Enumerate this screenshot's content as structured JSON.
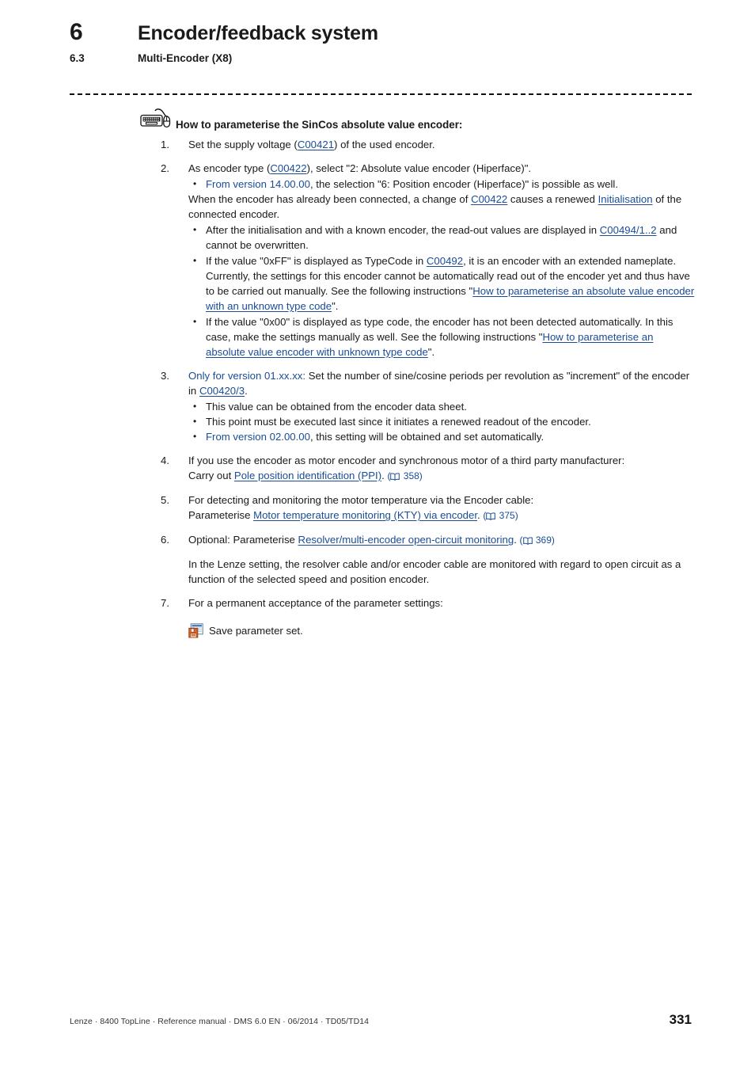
{
  "header": {
    "chapter_number": "6",
    "chapter_title": "Encoder/feedback system",
    "section_number": "6.3",
    "section_title": "Multi-Encoder (X8)"
  },
  "instruction": {
    "icon": "keyboard-mouse-icon",
    "title": "How to parameterise the SinCos absolute value encoder:",
    "steps": [
      {
        "number": "1.",
        "text_parts": [
          {
            "type": "text",
            "value": "Set the supply voltage ("
          },
          {
            "type": "link",
            "value": "C00421"
          },
          {
            "type": "text",
            "value": ") of the used encoder."
          }
        ]
      },
      {
        "number": "2.",
        "text_parts": [
          {
            "type": "text",
            "value": "As encoder type ("
          },
          {
            "type": "link",
            "value": "C00422"
          },
          {
            "type": "text",
            "value": "), select \"2: Absolute value encoder (Hiperface)\"."
          }
        ],
        "bullets": [
          [
            {
              "type": "blue",
              "value": "From version 14.00.00"
            },
            {
              "type": "text",
              "value": ", the selection \"6: Position encoder (Hiperface)\" is possible as well."
            }
          ]
        ],
        "paragraph": [
          {
            "type": "text",
            "value": "When the encoder has already been connected, a change of "
          },
          {
            "type": "link",
            "value": "C00422"
          },
          {
            "type": "text",
            "value": " causes a renewed "
          },
          {
            "type": "link",
            "value": "Initialisation"
          },
          {
            "type": "text",
            "value": " of the connected encoder."
          }
        ],
        "bullets2": [
          [
            {
              "type": "text",
              "value": "After the initialisation and with a known encoder, the read-out values are displayed in "
            },
            {
              "type": "link",
              "value": "C00494/1..2"
            },
            {
              "type": "text",
              "value": " and cannot be overwritten."
            }
          ],
          [
            {
              "type": "text",
              "value": "If the value \"0xFF\" is displayed as TypeCode in "
            },
            {
              "type": "link",
              "value": "C00492"
            },
            {
              "type": "text",
              "value": ", it is an encoder with an extended nameplate. Currently, the settings for this encoder cannot be automatically read out of the encoder yet and thus have to be carried out manually. See the following instructions \""
            },
            {
              "type": "link",
              "value": "How to parameterise an absolute value encoder with an unknown type code"
            },
            {
              "type": "text",
              "value": "\"."
            }
          ],
          [
            {
              "type": "text",
              "value": "If the value \"0x00\" is displayed as type code, the encoder has not been detected automatically. In this case, make the settings manually as well. See the following instructions \""
            },
            {
              "type": "link",
              "value": "How to parameterise an absolute value encoder with unknown type code"
            },
            {
              "type": "text",
              "value": "\"."
            }
          ]
        ]
      },
      {
        "number": "3.",
        "text_parts": [
          {
            "type": "blue",
            "value": "Only for version 01.xx.xx:"
          },
          {
            "type": "text",
            "value": " Set the number of sine/cosine periods per revolution as \"increment\" of the encoder in "
          },
          {
            "type": "link",
            "value": "C00420/3"
          },
          {
            "type": "text",
            "value": "."
          }
        ],
        "bullets": [
          [
            {
              "type": "text",
              "value": "This value can be obtained from the encoder data sheet."
            }
          ],
          [
            {
              "type": "text",
              "value": "This point must be executed last since it initiates a renewed readout of the encoder."
            }
          ],
          [
            {
              "type": "blue",
              "value": "From version 02.00.00"
            },
            {
              "type": "text",
              "value": ", this setting will be obtained and set automatically."
            }
          ]
        ]
      },
      {
        "number": "4.",
        "text_parts": [
          {
            "type": "text",
            "value": "If you use the encoder as motor encoder and synchronous motor of a third party manufacturer:"
          },
          {
            "type": "break"
          },
          {
            "type": "text",
            "value": "Carry out "
          },
          {
            "type": "link",
            "value": "Pole position identification (PPI)"
          },
          {
            "type": "text",
            "value": ". "
          },
          {
            "type": "pageref",
            "value": "358"
          }
        ]
      },
      {
        "number": "5.",
        "text_parts": [
          {
            "type": "text",
            "value": "For detecting and monitoring the motor temperature via the Encoder cable:"
          },
          {
            "type": "break"
          },
          {
            "type": "text",
            "value": "Parameterise "
          },
          {
            "type": "link",
            "value": "Motor temperature monitoring (KTY) via encoder"
          },
          {
            "type": "text",
            "value": ". "
          },
          {
            "type": "pageref",
            "value": "375"
          }
        ]
      },
      {
        "number": "6.",
        "text_parts": [
          {
            "type": "text",
            "value": "Optional: Parameterise "
          },
          {
            "type": "link",
            "value": "Resolver/multi-encoder open-circuit monitoring"
          },
          {
            "type": "text",
            "value": ". "
          },
          {
            "type": "pageref",
            "value": "369"
          }
        ],
        "paragraph": [
          {
            "type": "text",
            "value": "In the Lenze setting, the resolver cable and/or encoder cable are monitored with regard to open circuit as a function of the selected speed and position encoder."
          }
        ]
      },
      {
        "number": "7.",
        "text_parts": [
          {
            "type": "text",
            "value": "For a permanent acceptance of the parameter settings:"
          }
        ]
      }
    ],
    "save_action": {
      "icon": "save-parameter-set-icon",
      "label": "Save parameter set."
    }
  },
  "footer": {
    "text": "Lenze · 8400 TopLine · Reference manual · DMS 6.0 EN · 06/2014 · TD05/TD14",
    "page_number": "331"
  },
  "colors": {
    "link": "#1A4C97",
    "text": "#1a1a1a",
    "rule": "#111111"
  }
}
